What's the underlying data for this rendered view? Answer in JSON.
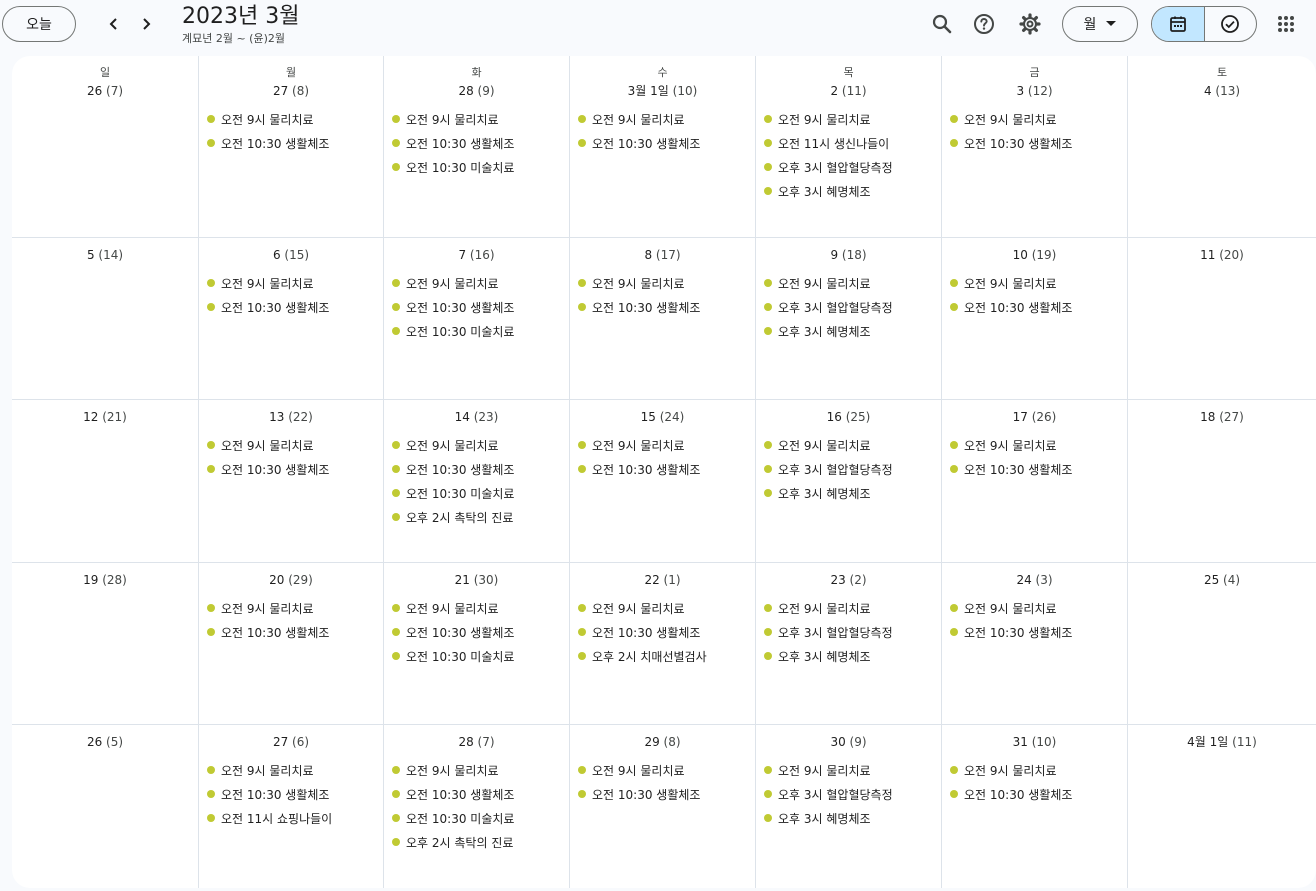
{
  "header": {
    "today_label": "오늘",
    "title": "2023년 3월",
    "subtitle": "계묘년 2월 ~ (윤)2월",
    "view_label": "월"
  },
  "colors": {
    "event_dot": "#c0ca33",
    "active_segment": "#c2e7ff"
  },
  "icons": [
    "chevron-left-icon",
    "chevron-right-icon",
    "search-icon",
    "help-icon",
    "settings-icon",
    "dropdown-arrow-icon",
    "calendar-icon",
    "tasks-check-icon",
    "apps-grid-icon"
  ],
  "calendar": {
    "days_of_week": [
      "일",
      "월",
      "화",
      "수",
      "목",
      "금",
      "토"
    ],
    "weeks": [
      [
        {
          "date": "26",
          "lunar": "(7)",
          "events": []
        },
        {
          "date": "27",
          "lunar": "(8)",
          "events": [
            "오전 9시 물리치료",
            "오전 10:30 생활체조"
          ]
        },
        {
          "date": "28",
          "lunar": "(9)",
          "events": [
            "오전 9시 물리치료",
            "오전 10:30 생활체조",
            "오전 10:30 미술치료"
          ]
        },
        {
          "date": "3월 1일",
          "lunar": "(10)",
          "events": [
            "오전 9시 물리치료",
            "오전 10:30 생활체조"
          ]
        },
        {
          "date": "2",
          "lunar": "(11)",
          "events": [
            "오전 9시 물리치료",
            "오전 11시 생신나들이",
            "오후 3시 혈압혈당측정",
            "오후 3시 혜명체조"
          ]
        },
        {
          "date": "3",
          "lunar": "(12)",
          "events": [
            "오전 9시 물리치료",
            "오전 10:30 생활체조"
          ]
        },
        {
          "date": "4",
          "lunar": "(13)",
          "events": []
        }
      ],
      [
        {
          "date": "5",
          "lunar": "(14)",
          "events": []
        },
        {
          "date": "6",
          "lunar": "(15)",
          "events": [
            "오전 9시 물리치료",
            "오전 10:30 생활체조"
          ]
        },
        {
          "date": "7",
          "lunar": "(16)",
          "events": [
            "오전 9시 물리치료",
            "오전 10:30 생활체조",
            "오전 10:30 미술치료"
          ]
        },
        {
          "date": "8",
          "lunar": "(17)",
          "events": [
            "오전 9시 물리치료",
            "오전 10:30 생활체조"
          ]
        },
        {
          "date": "9",
          "lunar": "(18)",
          "events": [
            "오전 9시 물리치료",
            "오후 3시 혈압혈당측정",
            "오후 3시 혜명체조"
          ]
        },
        {
          "date": "10",
          "lunar": "(19)",
          "events": [
            "오전 9시 물리치료",
            "오전 10:30 생활체조"
          ]
        },
        {
          "date": "11",
          "lunar": "(20)",
          "events": []
        }
      ],
      [
        {
          "date": "12",
          "lunar": "(21)",
          "events": []
        },
        {
          "date": "13",
          "lunar": "(22)",
          "events": [
            "오전 9시 물리치료",
            "오전 10:30 생활체조"
          ]
        },
        {
          "date": "14",
          "lunar": "(23)",
          "events": [
            "오전 9시 물리치료",
            "오전 10:30 생활체조",
            "오전 10:30 미술치료",
            "오후 2시 촉탁의 진료"
          ]
        },
        {
          "date": "15",
          "lunar": "(24)",
          "events": [
            "오전 9시 물리치료",
            "오전 10:30 생활체조"
          ]
        },
        {
          "date": "16",
          "lunar": "(25)",
          "events": [
            "오전 9시 물리치료",
            "오후 3시 혈압혈당측정",
            "오후 3시 혜명체조"
          ]
        },
        {
          "date": "17",
          "lunar": "(26)",
          "events": [
            "오전 9시 물리치료",
            "오전 10:30 생활체조"
          ]
        },
        {
          "date": "18",
          "lunar": "(27)",
          "events": []
        }
      ],
      [
        {
          "date": "19",
          "lunar": "(28)",
          "events": []
        },
        {
          "date": "20",
          "lunar": "(29)",
          "events": [
            "오전 9시 물리치료",
            "오전 10:30 생활체조"
          ]
        },
        {
          "date": "21",
          "lunar": "(30)",
          "events": [
            "오전 9시 물리치료",
            "오전 10:30 생활체조",
            "오전 10:30 미술치료"
          ]
        },
        {
          "date": "22",
          "lunar": "(1)",
          "events": [
            "오전 9시 물리치료",
            "오전 10:30 생활체조",
            "오후 2시 치매선별검사"
          ]
        },
        {
          "date": "23",
          "lunar": "(2)",
          "events": [
            "오전 9시 물리치료",
            "오후 3시 혈압혈당측정",
            "오후 3시 혜명체조"
          ]
        },
        {
          "date": "24",
          "lunar": "(3)",
          "events": [
            "오전 9시 물리치료",
            "오전 10:30 생활체조"
          ]
        },
        {
          "date": "25",
          "lunar": "(4)",
          "events": []
        }
      ],
      [
        {
          "date": "26",
          "lunar": "(5)",
          "events": []
        },
        {
          "date": "27",
          "lunar": "(6)",
          "events": [
            "오전 9시 물리치료",
            "오전 10:30 생활체조",
            "오전 11시 쇼핑나들이"
          ]
        },
        {
          "date": "28",
          "lunar": "(7)",
          "events": [
            "오전 9시 물리치료",
            "오전 10:30 생활체조",
            "오전 10:30 미술치료",
            "오후 2시 촉탁의 진료"
          ]
        },
        {
          "date": "29",
          "lunar": "(8)",
          "events": [
            "오전 9시 물리치료",
            "오전 10:30 생활체조"
          ]
        },
        {
          "date": "30",
          "lunar": "(9)",
          "events": [
            "오전 9시 물리치료",
            "오후 3시 혈압혈당측정",
            "오후 3시 혜명체조"
          ]
        },
        {
          "date": "31",
          "lunar": "(10)",
          "events": [
            "오전 9시 물리치료",
            "오전 10:30 생활체조"
          ]
        },
        {
          "date": "4월 1일",
          "lunar": "(11)",
          "events": []
        }
      ]
    ]
  }
}
